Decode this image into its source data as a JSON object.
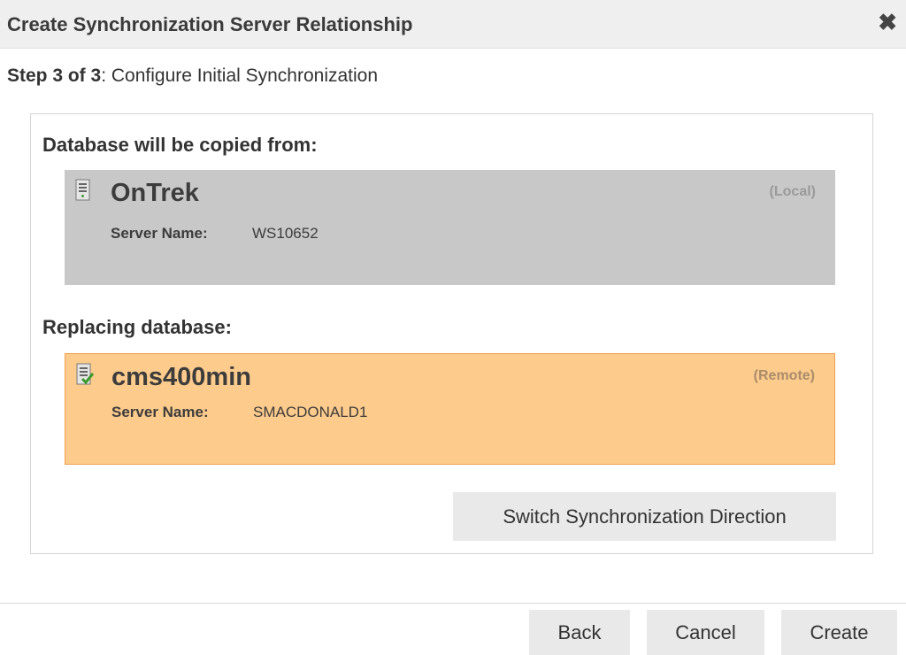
{
  "dialog": {
    "title": "Create Synchronization Server Relationship",
    "close_icon": "close-icon"
  },
  "step": {
    "prefix": "Step 3 of 3",
    "text": ": Configure Initial Synchronization"
  },
  "source": {
    "label": "Database will be copied from:",
    "name": "OnTrek",
    "tag": "(Local)",
    "server_label": "Server Name:",
    "server_value": "WS10652",
    "icon": "database-server-icon"
  },
  "target": {
    "label": "Replacing database:",
    "name": "cms400min",
    "tag": "(Remote)",
    "server_label": "Server Name:",
    "server_value": "SMACDONALD1",
    "icon": "database-server-check-icon"
  },
  "buttons": {
    "switch": "Switch Synchronization Direction",
    "back": "Back",
    "cancel": "Cancel",
    "create": "Create"
  },
  "colors": {
    "source_bg": "#c8c8c8",
    "target_bg": "#fdcb8c",
    "target_border": "#f0a04b"
  }
}
